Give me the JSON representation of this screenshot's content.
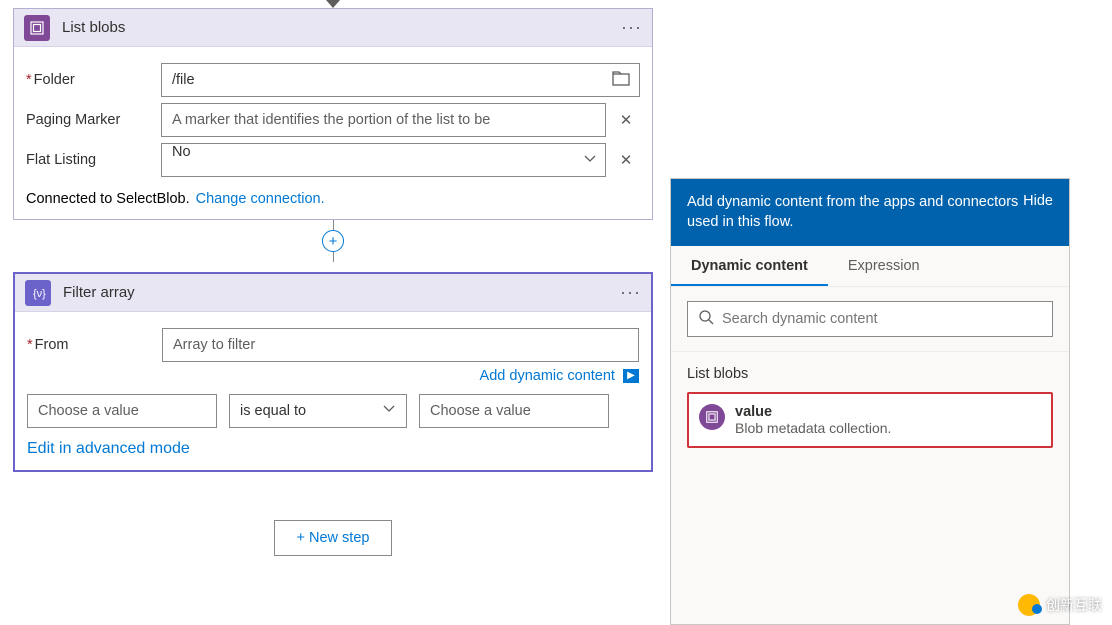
{
  "listBlobs": {
    "title": "List blobs",
    "folder_label": "Folder",
    "folder_value": "/file",
    "paging_label": "Paging Marker",
    "paging_placeholder": "A marker that identifies the portion of the list to be",
    "flat_label": "Flat Listing",
    "flat_value": "No",
    "connected_text": "Connected to SelectBlob.",
    "change_link": "Change connection."
  },
  "filterArray": {
    "title": "Filter array",
    "from_label": "From",
    "from_placeholder": "Array to filter",
    "add_dynamic": "Add dynamic content",
    "left_placeholder": "Choose a value",
    "op_value": "is equal to",
    "right_placeholder": "Choose a value",
    "advanced_link": "Edit in advanced mode"
  },
  "newStep": "+ New step",
  "panel": {
    "header_text": "Add dynamic content from the apps and connectors used in this flow.",
    "hide": "Hide",
    "tab_dynamic": "Dynamic content",
    "tab_expression": "Expression",
    "search_placeholder": "Search dynamic content",
    "section": "List blobs",
    "item_title": "value",
    "item_desc": "Blob metadata collection."
  },
  "watermark": "创新互联"
}
